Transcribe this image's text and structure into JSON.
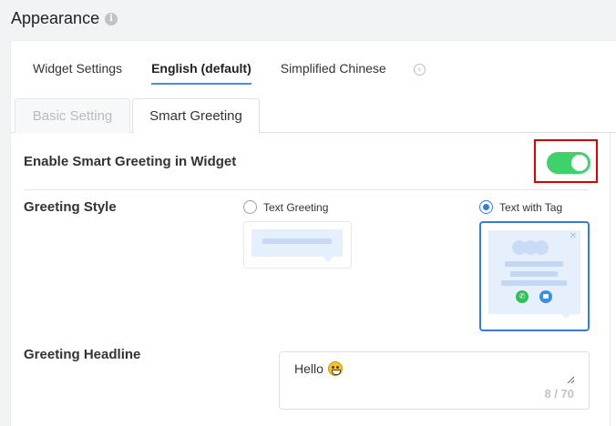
{
  "header": {
    "title": "Appearance",
    "info_icon": "info-icon"
  },
  "language_tabs": [
    {
      "label": "Widget Settings",
      "active": false
    },
    {
      "label": "English (default)",
      "active": true
    },
    {
      "label": "Simplified Chinese",
      "active": false
    }
  ],
  "sub_tabs": [
    {
      "label": "Basic Setting",
      "active": false
    },
    {
      "label": "Smart Greeting",
      "active": true
    }
  ],
  "smart_greeting": {
    "enable_label": "Enable Smart Greeting in Widget",
    "enabled": true,
    "toggle_color": "#3fd16b",
    "highlight_color": "#e00000"
  },
  "greeting_style": {
    "label": "Greeting Style",
    "options": [
      {
        "label": "Text Greeting",
        "selected": false
      },
      {
        "label": "Text with Tag",
        "selected": true
      }
    ],
    "accent_color": "#2f7de1"
  },
  "greeting_headline": {
    "label": "Greeting Headline",
    "value": "Hello",
    "emoji": "grinning-face-emoji",
    "counter": "8 / 70"
  }
}
